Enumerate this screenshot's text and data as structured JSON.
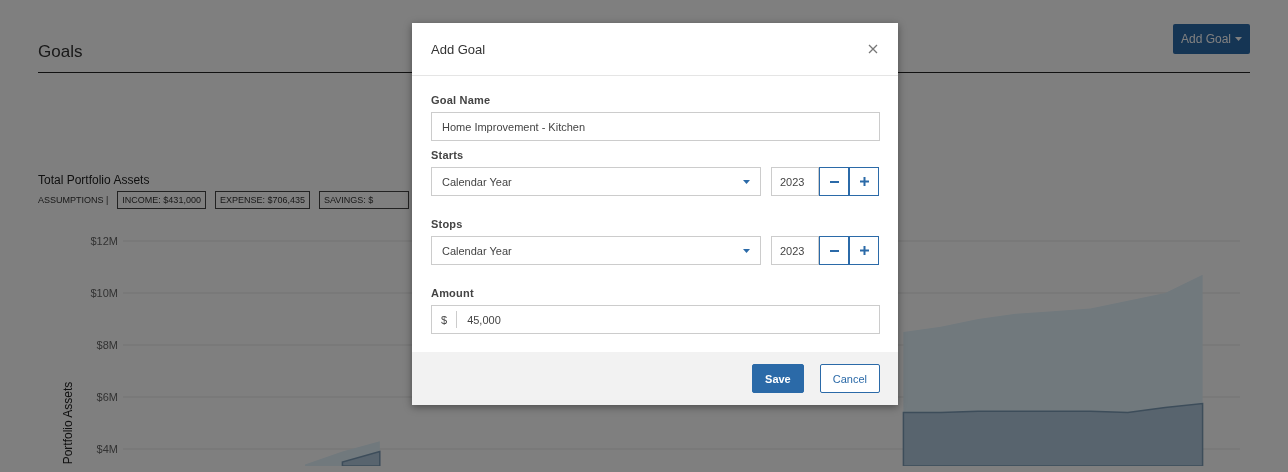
{
  "page": {
    "title": "Goals",
    "add_button": "Add Goal"
  },
  "chart_section": {
    "title": "Total Portfolio Assets",
    "assumptions_label": "ASSUMPTIONS |",
    "assumptions": [
      "INCOME: $431,000",
      "EXPENSE: $706,435",
      "SAVINGS: $"
    ],
    "chart": {
      "y_axis_title": "Portfolio Assets",
      "y_axis_labels": [
        "$12M",
        "$10M",
        "$8M",
        "$6M",
        "$4M"
      ]
    }
  },
  "dialog": {
    "title": "Add Goal",
    "fields": [
      {
        "kind": "text",
        "label": "Goal Name",
        "value": "Home Improvement - Kitchen"
      },
      {
        "kind": "period",
        "label": "Starts",
        "value": "Calendar Year",
        "year": "2023"
      },
      {
        "kind": "period",
        "label": "Stops",
        "value": "Calendar Year",
        "year": "2023"
      },
      {
        "kind": "currency",
        "label": "Amount",
        "prefix": "$",
        "value": "45,000"
      }
    ],
    "buttons": [
      {
        "label": "Save",
        "kind": "primary"
      },
      {
        "label": "Cancel",
        "kind": "secondary"
      }
    ]
  }
}
